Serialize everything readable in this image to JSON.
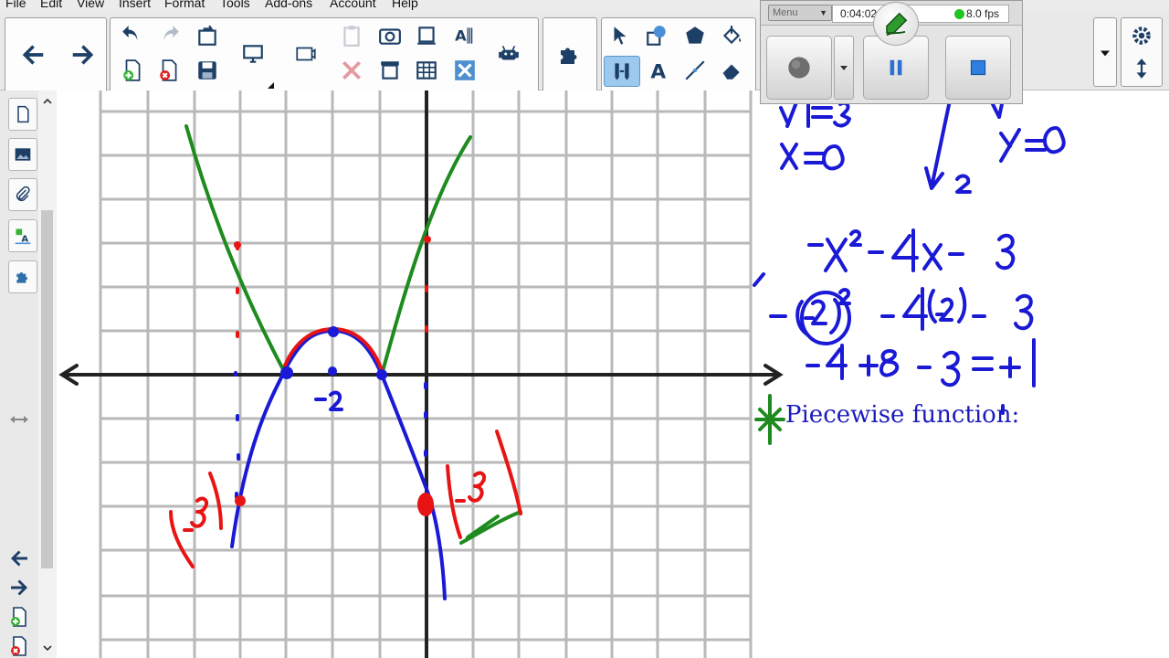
{
  "menu": [
    "File",
    "Edit",
    "View",
    "Insert",
    "Format",
    "Tools",
    "Add-ons",
    "Account",
    "Help"
  ],
  "recorder": {
    "menu_label": "Menu",
    "time": "0:04:02",
    "fps": "8.0 fps",
    "status_color": "#22c322"
  },
  "toolbar": {
    "back_icon": "arrow-left-icon",
    "forward_icon": "arrow-right-icon",
    "active_tool": "adjust-tool",
    "accent_color": "#9ec9ee"
  },
  "sidebar": {
    "icons": [
      "page-icon",
      "gallery-icon",
      "attachment-icon",
      "properties-icon",
      "addon-icon"
    ]
  },
  "board": {
    "annotation_text": "Piecewise function:",
    "ink_colors": {
      "blue": "#1a1ad6",
      "red": "#e81414",
      "green": "#1e8b1e",
      "grid": "#b9b9b9"
    }
  }
}
